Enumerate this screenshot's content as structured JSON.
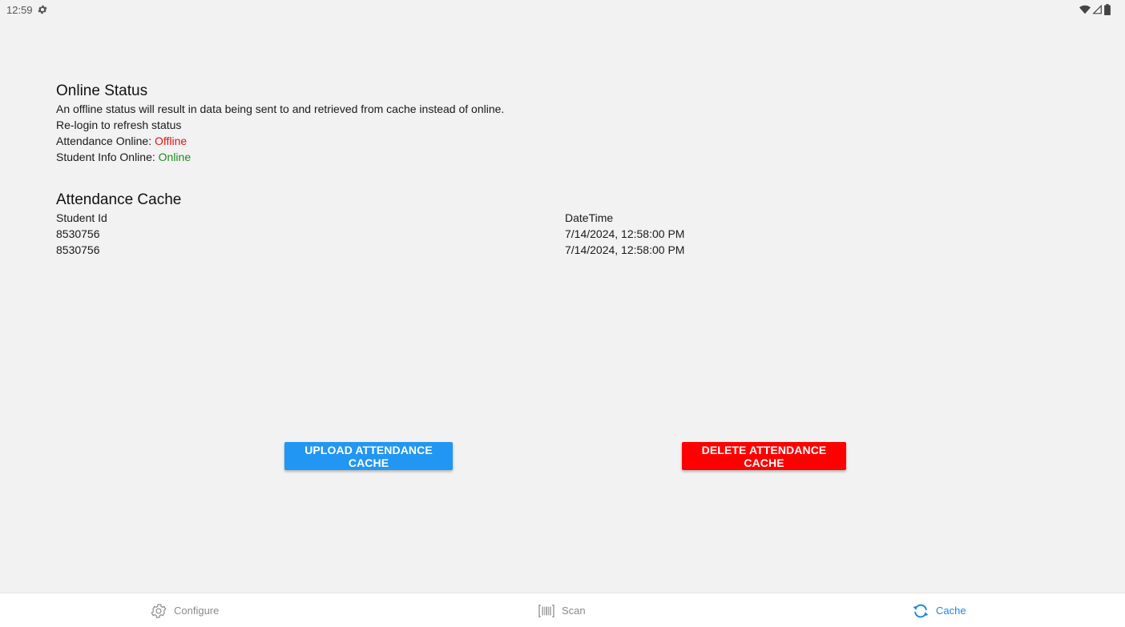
{
  "status_bar": {
    "time": "12:59"
  },
  "online_status": {
    "title": "Online Status",
    "description": "An offline status will result in data being sent to and retrieved from cache instead of online.",
    "relogin_hint": "Re-login to refresh status",
    "attendance_label": "Attendance Online: ",
    "attendance_value": "Offline",
    "student_info_label": "Student Info Online: ",
    "student_info_value": "Online"
  },
  "attendance_cache": {
    "title": "Attendance Cache",
    "columns": [
      "Student Id",
      "DateTime"
    ],
    "rows": [
      [
        "8530756",
        "7/14/2024, 12:58:00 PM"
      ],
      [
        "8530756",
        "7/14/2024, 12:58:00 PM"
      ]
    ]
  },
  "buttons": {
    "upload_label": "UPLOAD ATTENDANCE CACHE",
    "delete_label": "DELETE ATTENDANCE CACHE"
  },
  "bottom_nav": {
    "items": [
      {
        "label": "Configure",
        "icon": "gear-icon"
      },
      {
        "label": "Scan",
        "icon": "barcode-icon"
      },
      {
        "label": "Cache",
        "icon": "sync-icon",
        "active": true
      }
    ]
  },
  "colors": {
    "background": "#f2f2f2",
    "offline": "#e01515",
    "online": "#1e8a1e",
    "upload_button": "#2196f3",
    "delete_button": "#fe0000",
    "active_tab": "#1e88e5",
    "inactive_tab": "#8a8a8a"
  }
}
